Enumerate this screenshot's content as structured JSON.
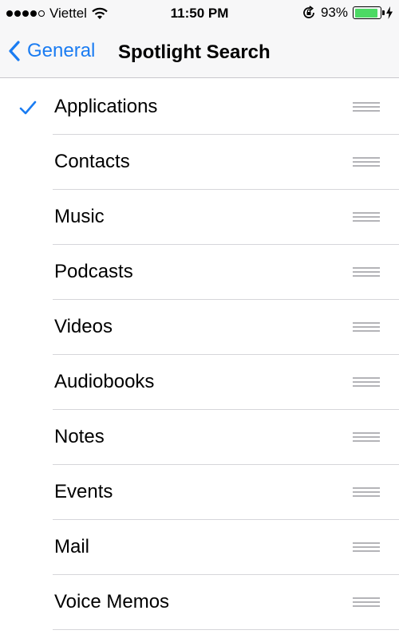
{
  "status_bar": {
    "carrier": "Viettel",
    "time": "11:50 PM",
    "battery_percent": "93%",
    "battery_level": 0.93,
    "signal_dots_filled": 4,
    "signal_dots_total": 5
  },
  "nav": {
    "back_label": "General",
    "title": "Spotlight Search"
  },
  "colors": {
    "accent": "#1a7cf2",
    "battery": "#4cd964"
  },
  "items": [
    {
      "label": "Applications",
      "checked": true
    },
    {
      "label": "Contacts",
      "checked": false
    },
    {
      "label": "Music",
      "checked": false
    },
    {
      "label": "Podcasts",
      "checked": false
    },
    {
      "label": "Videos",
      "checked": false
    },
    {
      "label": "Audiobooks",
      "checked": false
    },
    {
      "label": "Notes",
      "checked": false
    },
    {
      "label": "Events",
      "checked": false
    },
    {
      "label": "Mail",
      "checked": false
    },
    {
      "label": "Voice Memos",
      "checked": false
    }
  ]
}
